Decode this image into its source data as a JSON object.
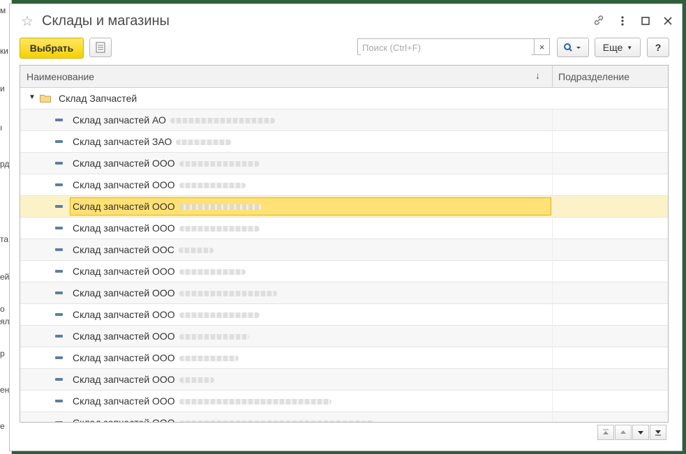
{
  "background": {
    "fragments": [
      "м",
      "ки",
      "и",
      "ı",
      "рд",
      "та",
      "ей",
      "о",
      "ял",
      "р",
      "ен",
      "е"
    ]
  },
  "window": {
    "title": "Склады и магазины",
    "icons": [
      "link-icon",
      "more-vertical-icon",
      "maximize-icon",
      "close-icon"
    ]
  },
  "toolbar": {
    "select_label": "Выбрать",
    "search_placeholder": "Поиск (Ctrl+F)",
    "search_value": "",
    "clear_label": "×",
    "more_label": "Еще",
    "help_label": "?"
  },
  "grid": {
    "columns": {
      "name": "Наименование",
      "sort_indicator": "↓",
      "department": "Подразделение"
    },
    "group": {
      "label": "Склад Запчастей"
    },
    "items": [
      {
        "label": "Склад запчастей АО",
        "blur_width": 150
      },
      {
        "label": "Склад запчастей ЗАО",
        "blur_width": 80
      },
      {
        "label": "Склад запчастей ООО",
        "blur_width": 115
      },
      {
        "label": "Склад запчастей ООО",
        "blur_width": 95
      },
      {
        "label": "Склад запчастей ООО",
        "blur_width": 118,
        "selected": true
      },
      {
        "label": "Склад запчастей ООО",
        "blur_width": 115
      },
      {
        "label": "Склад запчастей ООС",
        "blur_width": 50
      },
      {
        "label": "Склад запчастей ООО",
        "blur_width": 95
      },
      {
        "label": "Склад запчастей ООО",
        "blur_width": 140
      },
      {
        "label": "Склад запчастей ООО",
        "blur_width": 115
      },
      {
        "label": "Склад запчастей ООО",
        "blur_width": 100
      },
      {
        "label": "Склад запчастей ООО",
        "blur_width": 85
      },
      {
        "label": "Склад запчастей ООО",
        "blur_width": 50
      },
      {
        "label": "Склад запчастей ООО",
        "blur_width": 218
      },
      {
        "label": "Склад запчастей ООО",
        "blur_width": 280
      }
    ]
  },
  "colors": {
    "accent_button": "#f5d100",
    "selected_row": "#fbf2c8",
    "selected_cell": "#ffe176",
    "frame": "#2f5e3a"
  }
}
